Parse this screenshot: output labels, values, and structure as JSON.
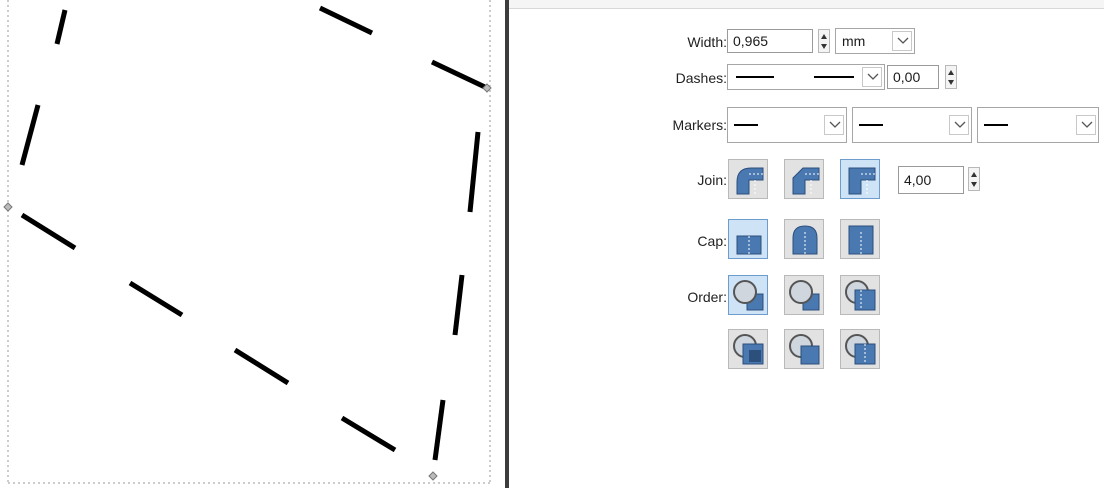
{
  "stroke_style": {
    "width": {
      "label": "Width:",
      "value": "0,965",
      "unit": "mm"
    },
    "dashes": {
      "label": "Dashes:",
      "offset": "0,00"
    },
    "markers": {
      "label": "Markers:"
    },
    "join": {
      "label": "Join:",
      "miter_limit": "4,00",
      "options": [
        "round-join",
        "bevel-join",
        "miter-join"
      ],
      "selected": "miter-join"
    },
    "cap": {
      "label": "Cap:",
      "options": [
        "butt-cap",
        "round-cap",
        "square-cap"
      ],
      "selected": "butt-cap"
    },
    "order": {
      "label": "Order:",
      "options": [
        "fill-stroke-markers",
        "stroke-fill-markers",
        "fill-markers-stroke",
        "markers-fill-stroke",
        "stroke-markers-fill",
        "markers-stroke-fill"
      ],
      "selected": "fill-stroke-markers"
    }
  },
  "colors": {
    "accent": "#4a78b0",
    "active_bg": "#cfe3f7",
    "button_bg": "#e2e2e2",
    "divider": "#3c3c3c"
  }
}
